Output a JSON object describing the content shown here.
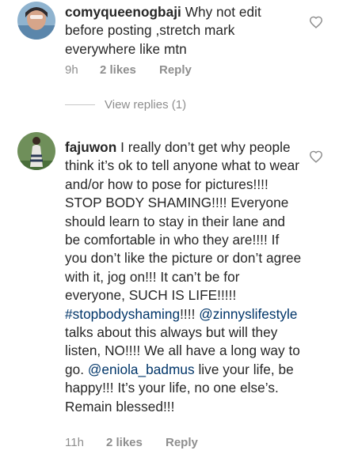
{
  "comments": [
    {
      "username": "comyqueenogbaji",
      "text": "Why not edit before posting ,stretch mark everywhere like mtn",
      "time": "9h",
      "likes": "2 likes",
      "reply": "Reply",
      "view_replies": "View replies (1)"
    },
    {
      "username": "fajuwon",
      "text_1": "I really don’t get why people think it’s ok to tell anyone what to wear and/or how to pose for pictures!!!! STOP BODY SHAMING!!!! Everyone should learn to stay in their lane and be comfortable in who they are!!!! If you don’t like the picture or don’t agree with it, jog on!!! It can’t be for everyone, SUCH IS LIFE!!!!!",
      "hashtag": "#stopbodyshaming",
      "text_2": "!!!!",
      "mention_1": "@zinnyslifestyle",
      "text_3": "talks about this always but will they listen, NO!!!! We all have a long way to go.",
      "mention_2": "@eniola_badmus",
      "text_4": "live your life, be happy!!! It’s your life, no one else’s. Remain blessed!!!",
      "time": "11h",
      "likes": "2 likes",
      "reply": "Reply"
    }
  ],
  "icons": [
    "heart-icon"
  ],
  "colors": {
    "link": "#003569",
    "meta": "#8e8e8e",
    "text": "#262626"
  }
}
